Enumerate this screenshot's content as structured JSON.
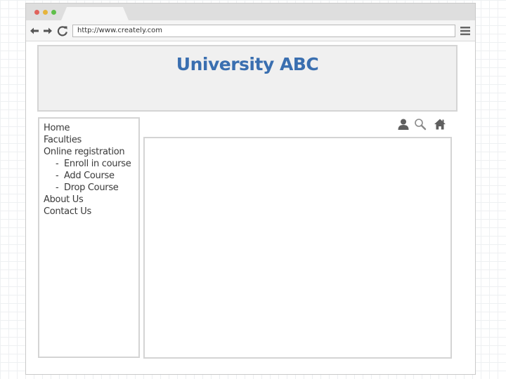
{
  "browser": {
    "window_controls": {
      "close_color": "#e0635c",
      "minimize_color": "#e6b43b",
      "maximize_color": "#5fbf4a"
    },
    "toolbar": {
      "back_icon": "arrow-left-icon",
      "forward_icon": "arrow-right-icon",
      "reload_icon": "reload-icon",
      "menu_icon": "hamburger-menu-icon"
    },
    "address_bar": {
      "url": "http://www.creately.com"
    }
  },
  "header": {
    "title": "University ABC",
    "title_color": "#3a6fb0"
  },
  "sidebar": {
    "items": [
      {
        "label": "Home"
      },
      {
        "label": "Faculties"
      },
      {
        "label": "Online registration"
      },
      {
        "label": "Enroll in course",
        "prefix": "-"
      },
      {
        "label": "Add Course",
        "prefix": "-"
      },
      {
        "label": "Drop Course",
        "prefix": "-"
      },
      {
        "label": "About Us"
      },
      {
        "label": "Contact Us"
      }
    ]
  },
  "utility_icons": [
    "user-icon",
    "search-icon",
    "home-icon"
  ],
  "main": {
    "content_panel": "empty"
  }
}
